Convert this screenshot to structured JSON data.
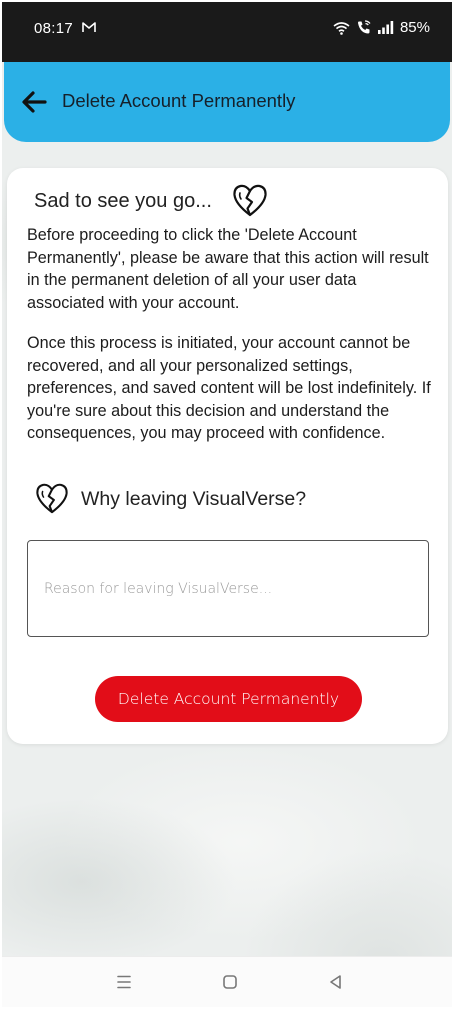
{
  "status_bar": {
    "time": "08:17",
    "battery": "85%"
  },
  "app_bar": {
    "title": "Delete Account Permanently",
    "back_icon": "arrow-left-icon"
  },
  "card": {
    "heading": "Sad to see you go...",
    "heading_icon": "broken-heart-icon",
    "paragraph_1": "Before proceeding to click the 'Delete Account Permanently', please be aware that this action will result in the permanent deletion of all your user data associated with your account.",
    "paragraph_2": "Once this process is initiated, your account cannot be recovered, and all your personalized settings, preferences, and saved content will be lost indefinitely. If you're sure about this decision and understand the consequences, you may proceed with confidence.",
    "why_label": "Why leaving VisualVerse?",
    "reason_placeholder": "Reason for leaving VisualVerse...",
    "reason_value": "",
    "delete_button_label": "Delete Account Permanently"
  },
  "colors": {
    "app_bar": "#2bb0e6",
    "delete_button": "#e20d18",
    "status_bar": "#1a1a1a"
  },
  "nav_bar": {
    "icons": [
      "recent-apps-icon",
      "home-icon",
      "back-triangle-icon"
    ]
  }
}
